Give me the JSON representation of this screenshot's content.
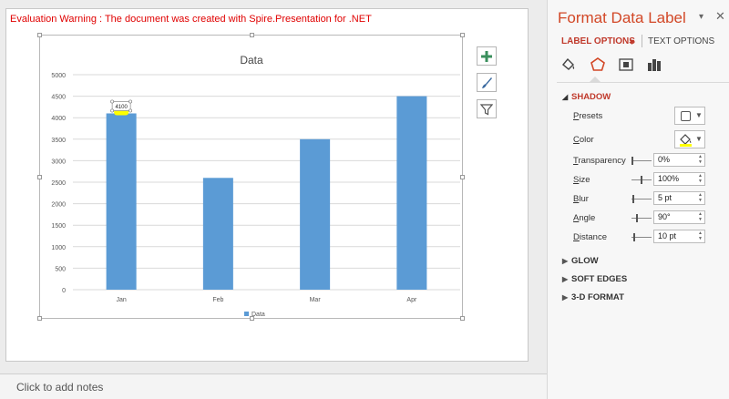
{
  "editor": {
    "warning": "Evaluation Warning : The document was created with  Spire.Presentation for .NET",
    "notes_placeholder": "Click to add notes"
  },
  "chart_data": {
    "type": "bar",
    "title": "Data",
    "categories": [
      "Jan",
      "Feb",
      "Mar",
      "Apr"
    ],
    "series": [
      {
        "name": "Data",
        "values": [
          4100,
          2600,
          3500,
          4500
        ],
        "color": "#5b9bd5"
      }
    ],
    "ylim": [
      0,
      5000
    ],
    "yticks": [
      "0",
      "500",
      "1000",
      "1500",
      "2000",
      "2500",
      "3000",
      "3500",
      "4000",
      "4500",
      "5000"
    ],
    "grid": true,
    "legend": "bottom",
    "data_label": {
      "category": "Jan",
      "text": "4100",
      "shadow_color": "#ffff00"
    }
  },
  "chart_buttons": [
    "chart-elements-icon",
    "chart-styles-icon",
    "chart-filters-icon"
  ],
  "pane": {
    "title": "Format Data Label",
    "tabs": {
      "label_options": "LABEL OPTIONS",
      "text_options": "TEXT OPTIONS"
    },
    "icons": [
      "fill-line-icon",
      "effects-icon",
      "size-properties-icon",
      "label-options-icon"
    ],
    "sections": {
      "shadow": "SHADOW",
      "glow": "GLOW",
      "soft_edges": "SOFT EDGES",
      "three_d": "3-D FORMAT"
    },
    "shadow": {
      "presets_label": "Presets",
      "color_label": "Color",
      "color_value": "#ffff00",
      "transparency_label": "Transparency",
      "transparency_value": "0%",
      "size_label": "Size",
      "size_value": "100%",
      "blur_label": "Blur",
      "blur_value": "5 pt",
      "angle_label": "Angle",
      "angle_value": "90°",
      "distance_label": "Distance",
      "distance_value": "10 pt"
    }
  }
}
